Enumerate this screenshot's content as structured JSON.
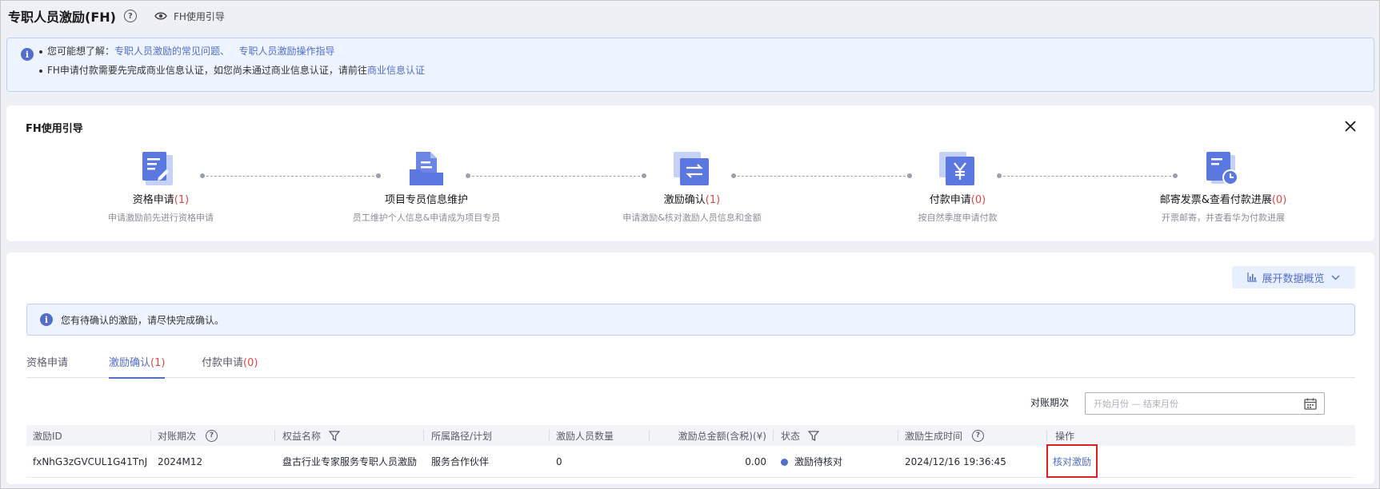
{
  "header": {
    "title": "专职人员激励(FH)",
    "help_symbol": "?",
    "guide_link": "FH使用引导"
  },
  "info_banner": {
    "line1_prefix": "您可能想了解：",
    "link_faq": "专职人员激励的常见问题、",
    "link_guide": "专职人员激励操作指导",
    "line2_text": "FH申请付款需要先完成商业信息认证，如您尚未通过商业信息认证，请前往",
    "line2_link": "商业信息认证"
  },
  "guide": {
    "title": "FH使用引导",
    "steps": [
      {
        "title": "资格申请",
        "count": "(1)",
        "desc": "申请激励前先进行资格申请",
        "icon": "document-edit-icon"
      },
      {
        "title": "项目专员信息维护",
        "count": "",
        "desc": "员工维护个人信息&申请成为项目专员",
        "icon": "document-folder-icon"
      },
      {
        "title": "激励确认",
        "count": "(1)",
        "desc": "申请激励&核对激励人员信息和金额",
        "icon": "swap-arrows-icon"
      },
      {
        "title": "付款申请",
        "count": "(0)",
        "desc": "按自然季度申请付款",
        "icon": "yen-icon"
      },
      {
        "title": "邮寄发票&查看付款进展",
        "count": "(0)",
        "desc": "开票邮寄，并查看华为付款进展",
        "icon": "document-clock-icon"
      }
    ]
  },
  "main": {
    "expand_button": "展开数据概览",
    "notice": "您有待确认的激励，请尽快完成确认。",
    "tabs": [
      {
        "label": "资格申请",
        "count": ""
      },
      {
        "label": "激励确认",
        "count": "(1)"
      },
      {
        "label": "付款申请",
        "count": "(0)"
      }
    ],
    "filter": {
      "label": "对账期次",
      "placeholder": "开始月份 — 结束月份"
    },
    "table": {
      "headers": [
        "激励ID",
        "对账期次",
        "权益名称",
        "所属路径/计划",
        "激励人员数量",
        "激励总金额(含税)(¥)",
        "状态",
        "激励生成时间",
        "操作"
      ],
      "rows": [
        {
          "id": "fxNhG3zGVCUL1G41TnJ",
          "period": "2024M12",
          "benefit": "盘古行业专家服务专职人员激励",
          "path": "服务合作伙伴",
          "headcount": "0",
          "amount": "0.00",
          "status": "激励待核对",
          "created": "2024/12/16 19:36:45",
          "action": "核对激励"
        }
      ]
    }
  },
  "colors": {
    "accent": "#526ecc",
    "count_red": "#e54545",
    "highlight_box": "#e02020"
  }
}
